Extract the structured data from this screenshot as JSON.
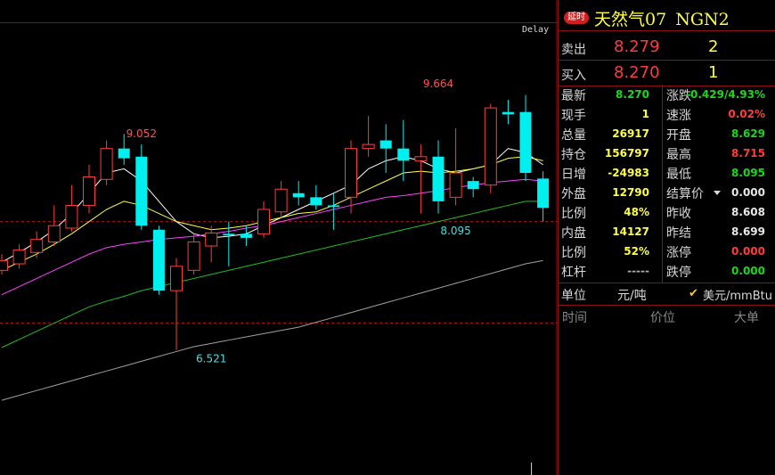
{
  "header": {
    "delay_tag": "延时",
    "name": "天然气07",
    "code": "NGN2",
    "delay_text": "Delay"
  },
  "orderbook": {
    "ask_label": "卖出",
    "ask_price": "8.279",
    "ask_vol": "2",
    "bid_label": "买入",
    "bid_price": "8.270",
    "bid_vol": "1"
  },
  "quote_rows": [
    {
      "l1": "最新",
      "v1": "8.270",
      "c1": "green",
      "l2": "涨跌",
      "v2": "-0.429/4.93%",
      "c2": "green"
    },
    {
      "l1": "现手",
      "v1": "1",
      "c1": "yellow",
      "l2": "速涨",
      "v2": "0.02%",
      "c2": "red"
    },
    {
      "l1": "总量",
      "v1": "26917",
      "c1": "yellow",
      "l2": "开盘",
      "v2": "8.629",
      "c2": "green"
    },
    {
      "l1": "持仓",
      "v1": "156797",
      "c1": "yellow",
      "l2": "最高",
      "v2": "8.715",
      "c2": "red"
    },
    {
      "l1": "日增",
      "v1": "-24983",
      "c1": "yellow",
      "l2": "最低",
      "v2": "8.095",
      "c2": "green"
    },
    {
      "l1": "外盘",
      "v1": "12790",
      "c1": "yellow",
      "l2": "结算价",
      "v2": "0.000",
      "c2": "white"
    },
    {
      "l1": "比例",
      "v1": "48%",
      "c1": "yellow",
      "l2": "昨收",
      "v2": "8.608",
      "c2": "white"
    },
    {
      "l1": "内盘",
      "v1": "14127",
      "c1": "yellow",
      "l2": "昨结",
      "v2": "8.699",
      "c2": "white"
    },
    {
      "l1": "比例",
      "v1": "52%",
      "c1": "yellow",
      "l2": "涨停",
      "v2": "0.000",
      "c2": "red"
    },
    {
      "l1": "杠杆",
      "v1": "-----",
      "c1": "gray",
      "l2": "跌停",
      "v2": "0.000",
      "c2": "green"
    }
  ],
  "units": {
    "label": "单位",
    "opt1": "元/吨",
    "opt2": "美元/mmBtu",
    "selected": "美元/mmBtu"
  },
  "ticks_header": {
    "time": "时间",
    "price": "价位",
    "big": "大单"
  },
  "chart_data": {
    "type": "candlestick",
    "ylim": [
      6.0,
      10.5
    ],
    "annotations": [
      {
        "text": "9.052",
        "x": 8,
        "y": 9.052,
        "color": "#ff5050"
      },
      {
        "text": "9.664",
        "x": 25,
        "y": 9.664,
        "color": "#ff5050"
      },
      {
        "text": "6.521",
        "x": 12,
        "y": 6.521,
        "color": "#40e0e0"
      },
      {
        "text": "8.095",
        "x": 26,
        "y": 8.095,
        "color": "#40e0e0"
      }
    ],
    "candles": [
      [
        7.5,
        7.62,
        7.7,
        7.45
      ],
      [
        7.58,
        7.75,
        7.82,
        7.52
      ],
      [
        7.72,
        7.88,
        7.98,
        7.65
      ],
      [
        7.85,
        8.05,
        8.3,
        7.8
      ],
      [
        8.02,
        8.3,
        8.55,
        7.98
      ],
      [
        8.3,
        8.65,
        8.8,
        8.2
      ],
      [
        8.62,
        9.0,
        9.1,
        8.55
      ],
      [
        9.0,
        8.88,
        9.18,
        8.8
      ],
      [
        8.9,
        8.05,
        9.05,
        8.0
      ],
      [
        8.0,
        7.25,
        8.05,
        7.2
      ],
      [
        7.25,
        7.55,
        7.65,
        6.52
      ],
      [
        7.5,
        7.85,
        7.95,
        7.45
      ],
      [
        7.8,
        7.96,
        8.05,
        7.6
      ],
      [
        7.95,
        7.93,
        8.1,
        7.55
      ],
      [
        7.95,
        7.9,
        8.05,
        7.8
      ],
      [
        7.95,
        8.25,
        8.35,
        7.9
      ],
      [
        8.22,
        8.5,
        8.6,
        8.15
      ],
      [
        8.45,
        8.4,
        8.6,
        8.3
      ],
      [
        8.4,
        8.3,
        8.55,
        8.25
      ],
      [
        8.3,
        8.28,
        8.45,
        8.0
      ],
      [
        8.4,
        9.0,
        9.1,
        8.2
      ],
      [
        9.0,
        9.05,
        9.4,
        8.9
      ],
      [
        9.1,
        9.0,
        9.3,
        8.7
      ],
      [
        9.0,
        8.85,
        9.35,
        8.6
      ],
      [
        8.85,
        8.9,
        9.05,
        8.2
      ],
      [
        8.9,
        8.35,
        9.1,
        8.2
      ],
      [
        8.4,
        8.7,
        9.25,
        8.3
      ],
      [
        8.6,
        8.5,
        8.65,
        8.4
      ],
      [
        8.55,
        9.5,
        9.55,
        8.45
      ],
      [
        9.45,
        9.42,
        9.6,
        9.3
      ],
      [
        9.45,
        8.7,
        9.66,
        8.6
      ],
      [
        8.63,
        8.27,
        8.72,
        8.1
      ]
    ],
    "ma_lines": [
      {
        "color": "#ffffff",
        "values": [
          7.6,
          7.72,
          7.85,
          8.0,
          8.2,
          8.45,
          8.7,
          8.75,
          8.6,
          8.35,
          8.1,
          7.95,
          7.9,
          7.92,
          7.95,
          8.05,
          8.15,
          8.25,
          8.35,
          8.45,
          8.55,
          8.75,
          8.85,
          8.9,
          8.85,
          8.75,
          8.7,
          8.75,
          8.8,
          9.0,
          8.95,
          8.8
        ]
      },
      {
        "color": "#ffff40",
        "values": [
          7.5,
          7.6,
          7.7,
          7.82,
          7.95,
          8.1,
          8.25,
          8.35,
          8.3,
          8.2,
          8.1,
          8.05,
          8.0,
          8.02,
          8.05,
          8.1,
          8.15,
          8.2,
          8.22,
          8.3,
          8.4,
          8.5,
          8.6,
          8.7,
          8.72,
          8.7,
          8.72,
          8.75,
          8.8,
          8.88,
          8.9,
          8.85
        ]
      },
      {
        "color": "#ff40ff",
        "values": [
          7.2,
          7.3,
          7.4,
          7.5,
          7.6,
          7.7,
          7.78,
          7.82,
          7.85,
          7.88,
          7.9,
          7.92,
          7.95,
          7.98,
          8.02,
          8.05,
          8.1,
          8.15,
          8.2,
          8.25,
          8.3,
          8.35,
          8.4,
          8.42,
          8.45,
          8.48,
          8.52,
          8.55,
          8.58,
          8.6,
          8.62,
          8.6
        ]
      },
      {
        "color": "#20c020",
        "values": [
          6.55,
          6.65,
          6.75,
          6.85,
          6.95,
          7.05,
          7.12,
          7.18,
          7.25,
          7.3,
          7.35,
          7.4,
          7.45,
          7.5,
          7.55,
          7.6,
          7.65,
          7.7,
          7.75,
          7.8,
          7.85,
          7.9,
          7.95,
          8.0,
          8.05,
          8.1,
          8.15,
          8.2,
          8.25,
          8.3,
          8.35,
          8.35
        ]
      },
      {
        "color": "#a0a0a0",
        "values": [
          5.9,
          5.96,
          6.02,
          6.08,
          6.14,
          6.2,
          6.26,
          6.32,
          6.38,
          6.44,
          6.5,
          6.56,
          6.6,
          6.64,
          6.68,
          6.72,
          6.76,
          6.8,
          6.86,
          6.92,
          6.98,
          7.04,
          7.1,
          7.16,
          7.22,
          7.28,
          7.34,
          7.4,
          7.46,
          7.52,
          7.58,
          7.62
        ]
      }
    ],
    "ref_lines": [
      8.1,
      6.85
    ]
  }
}
